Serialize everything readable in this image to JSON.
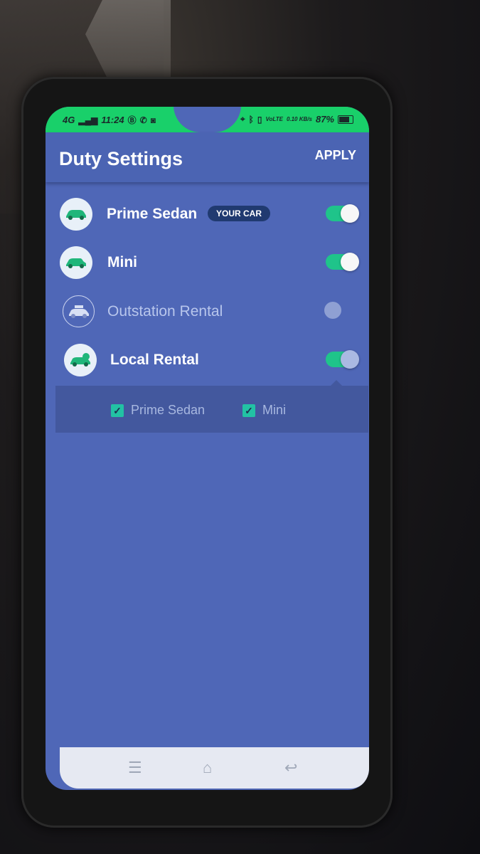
{
  "status_bar": {
    "network": "4G",
    "time": "11:24",
    "left_icons": [
      "b-circle-icon",
      "phone-icon",
      "instagram-icon"
    ],
    "right_icons": [
      "location-icon",
      "bluetooth-icon",
      "vibrate-icon",
      "volte-icon"
    ],
    "volte": "VoLTE",
    "speed": "0.10 KB/s",
    "battery": "87%"
  },
  "header": {
    "title": "Duty Settings",
    "apply_label": "APPLY"
  },
  "duty_items": [
    {
      "label": "Prime Sedan",
      "badge": "YOUR CAR",
      "enabled": true,
      "icon": "sedan-icon"
    },
    {
      "label": "Mini",
      "enabled": true,
      "icon": "hatchback-icon"
    },
    {
      "label": "Outstation Rental",
      "enabled": false,
      "icon": "car-luggage-icon"
    },
    {
      "label": "Local Rental",
      "enabled": true,
      "icon": "car-clock-icon"
    }
  ],
  "local_rental_options": [
    {
      "label": "Prime Sedan",
      "checked": true
    },
    {
      "label": "Mini",
      "checked": true
    }
  ],
  "colors": {
    "status_bar": "#19d06a",
    "background": "#4f67b7",
    "toggle_on": "#1fc48a",
    "badge": "#203a70"
  }
}
